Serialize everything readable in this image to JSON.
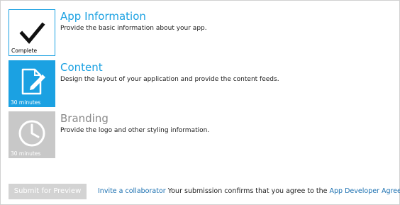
{
  "steps": [
    {
      "title": "App Information",
      "description": "Provide the basic information about your app.",
      "status": "Complete",
      "icon": "checkmark-icon",
      "state": "complete"
    },
    {
      "title": "Content",
      "description": "Design the layout of your application and provide the content feeds.",
      "status": "30 minutes",
      "icon": "edit-document-icon",
      "state": "active"
    },
    {
      "title": "Branding",
      "description": "Provide the logo and other styling information.",
      "status": "30 minutes",
      "icon": "clock-icon",
      "state": "disabled"
    }
  ],
  "footer": {
    "submit_label": "Submit for Preview",
    "invite_link": "Invite a collaborator",
    "agreement_text": "Your submission confirms that you agree to the",
    "agreement_link": "App Developer Agreement"
  },
  "colors": {
    "accent": "#1ba1e2",
    "disabled": "#c8c8c8",
    "link": "#1a6fb0"
  }
}
